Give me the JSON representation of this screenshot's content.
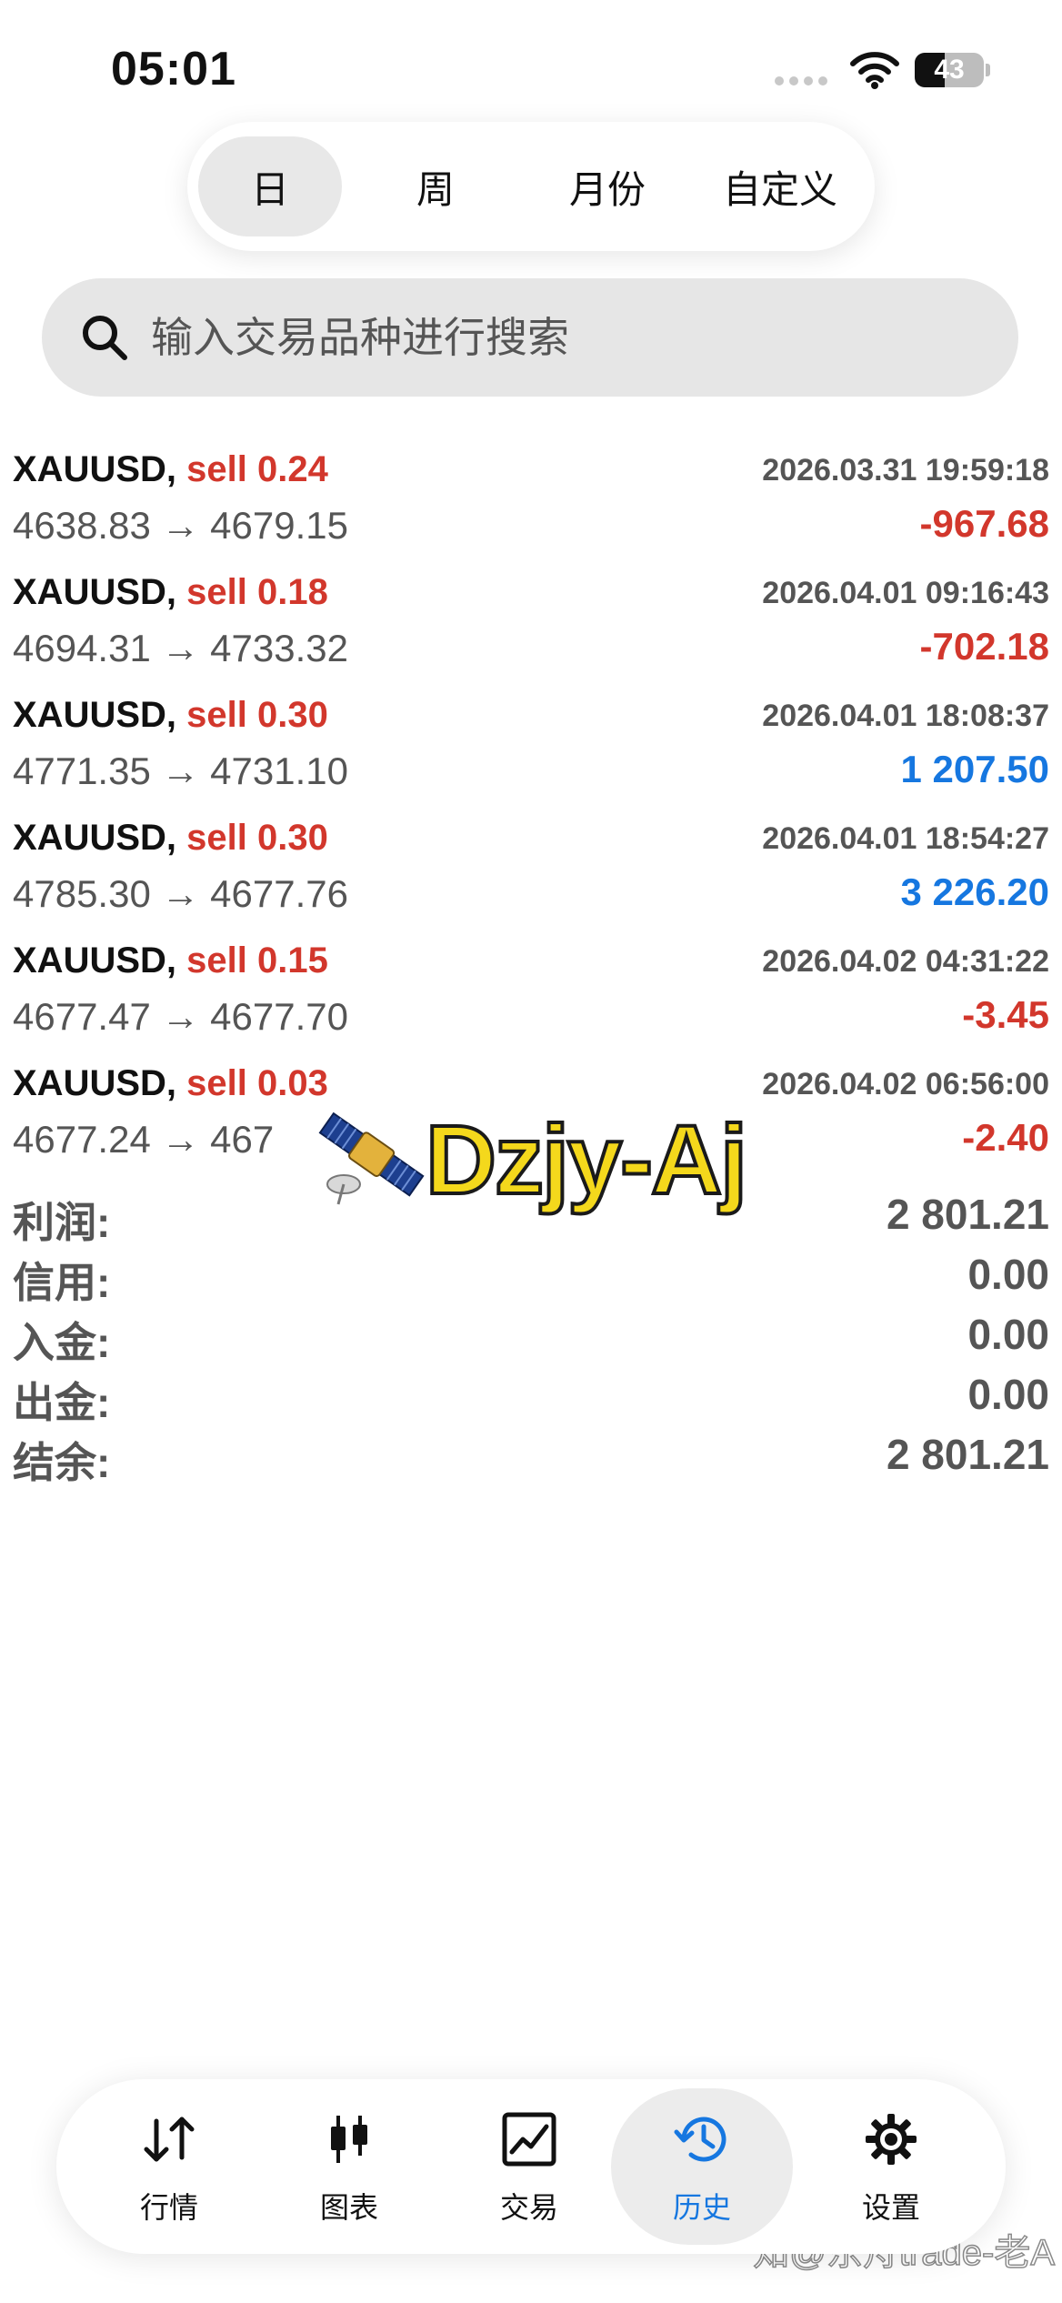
{
  "status_bar": {
    "time": "05:01",
    "battery_level": "43",
    "battery_fraction": 0.43
  },
  "period_tabs": {
    "items": [
      {
        "label": "日",
        "active": true
      },
      {
        "label": "周",
        "active": false
      },
      {
        "label": "月份",
        "active": false
      },
      {
        "label": "自定义",
        "active": false
      }
    ]
  },
  "search": {
    "placeholder": "输入交易品种进行搜索"
  },
  "trades": [
    {
      "symbol": "XAUUSD,",
      "side": "sell 0.24",
      "time": "2026.03.31 19:59:18",
      "prices": "4638.83 → 4679.15",
      "profit": "-967.68",
      "profit_sign": "negative"
    },
    {
      "symbol": "XAUUSD,",
      "side": "sell 0.18",
      "time": "2026.04.01 09:16:43",
      "prices": "4694.31 → 4733.32",
      "profit": "-702.18",
      "profit_sign": "negative"
    },
    {
      "symbol": "XAUUSD,",
      "side": "sell 0.30",
      "time": "2026.04.01 18:08:37",
      "prices": "4771.35 → 4731.10",
      "profit": "1 207.50",
      "profit_sign": "positive"
    },
    {
      "symbol": "XAUUSD,",
      "side": "sell 0.30",
      "time": "2026.04.01 18:54:27",
      "prices": "4785.30 → 4677.76",
      "profit": "3 226.20",
      "profit_sign": "positive"
    },
    {
      "symbol": "XAUUSD,",
      "side": "sell 0.15",
      "time": "2026.04.02 04:31:22",
      "prices": "4677.47 → 4677.70",
      "profit": "-3.45",
      "profit_sign": "negative"
    },
    {
      "symbol": "XAUUSD,",
      "side": "sell 0.03",
      "time": "2026.04.02 06:56:00",
      "prices": "4677.24 → 467",
      "profit": "-2.40",
      "profit_sign": "negative"
    }
  ],
  "summary": [
    {
      "label": "利润:",
      "value": "2 801.21"
    },
    {
      "label": "信用:",
      "value": "0.00"
    },
    {
      "label": "入金:",
      "value": "0.00"
    },
    {
      "label": "出金:",
      "value": "0.00"
    },
    {
      "label": "结余:",
      "value": "2 801.21"
    }
  ],
  "watermark": {
    "center_text": "Dzjy-Aj",
    "corner_text": "知@东舟trade-老A"
  },
  "bottom_nav": {
    "items": [
      {
        "label": "行情",
        "icon": "quotes-arrows-icon",
        "active": false
      },
      {
        "label": "图表",
        "icon": "candlestick-chart-icon",
        "active": false
      },
      {
        "label": "交易",
        "icon": "trade-line-chart-icon",
        "active": false
      },
      {
        "label": "历史",
        "icon": "history-clock-icon",
        "active": true
      },
      {
        "label": "设置",
        "icon": "settings-gear-icon",
        "active": false
      }
    ]
  },
  "colors": {
    "loss": "#d2372c",
    "profit": "#1677e0",
    "accent": "#1677e0",
    "watermark_yellow": "#f4d81c"
  }
}
